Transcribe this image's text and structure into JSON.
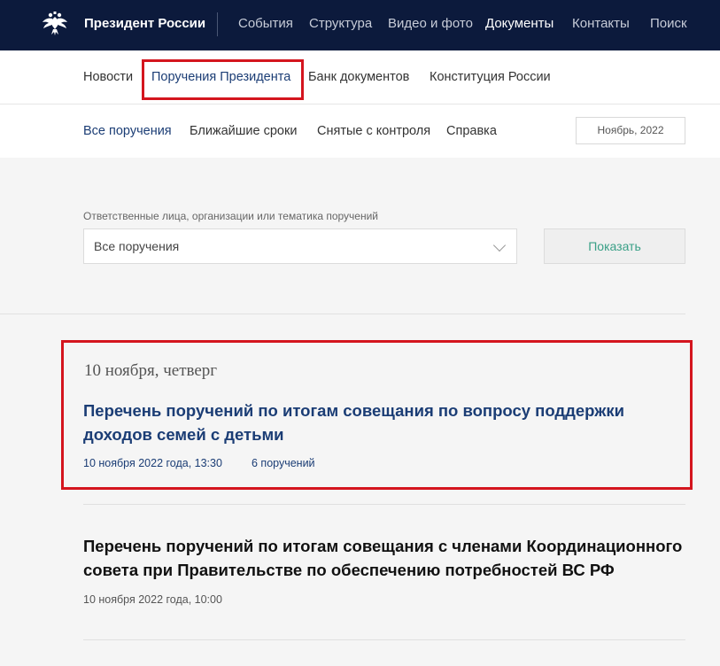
{
  "header": {
    "site_title": "Президент России",
    "nav": [
      "События",
      "Структура",
      "Видео и фото",
      "Документы",
      "Контакты",
      "Поиск"
    ],
    "active_nav": "Документы"
  },
  "subnav": {
    "items": [
      "Новости",
      "Поручения Президента",
      "Банк документов",
      "Конституция России"
    ],
    "active": "Поручения Президента"
  },
  "tabs": {
    "items": [
      "Все поручения",
      "Ближайшие сроки",
      "Снятые с контроля",
      "Справка"
    ],
    "active": "Все поручения",
    "month": "Ноябрь, 2022"
  },
  "filter": {
    "label": "Ответственные лица, организации или тематика поручений",
    "selected": "Все поручения",
    "submit_label": "Показать"
  },
  "list": {
    "date_heading": "10 ноября, четверг",
    "items": [
      {
        "title": "Перечень поручений по итогам совещания по вопросу поддержки доходов семей с детьми",
        "datetime": "10 ноября 2022 года, 13:30",
        "count": "6 поручений"
      },
      {
        "title": "Перечень поручений по итогам совещания с членами Координационного совета при Правительстве по обеспечению потребностей ВС РФ",
        "datetime": "10 ноября 2022 года, 10:00"
      }
    ]
  },
  "colors": {
    "header_bg": "#0c1a3c",
    "link_blue": "#1b3d75",
    "highlight_red": "#d4151e",
    "button_text_green": "#3aa087"
  }
}
